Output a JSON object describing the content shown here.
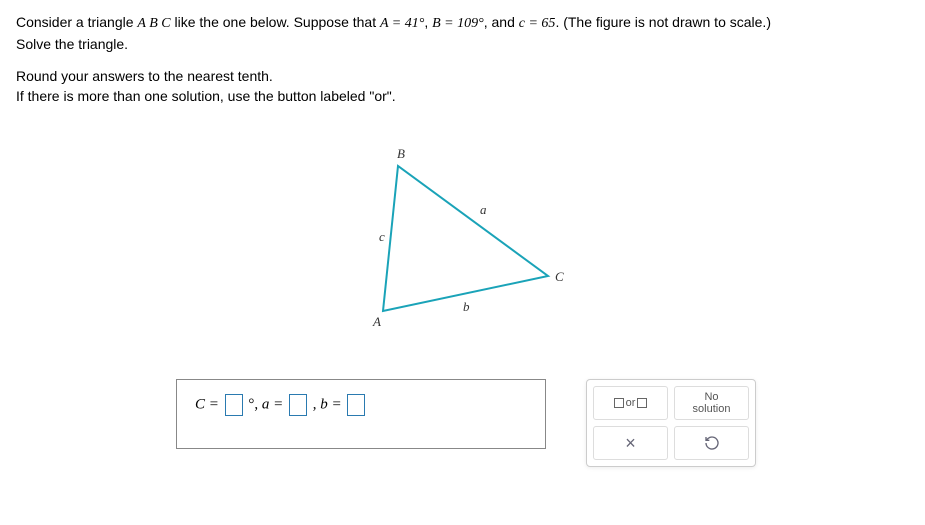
{
  "problem": {
    "line1_pre": "Consider a triangle ",
    "line1_abc": "A B C",
    "line1_mid": " like the one below. Suppose that ",
    "line1_A": "A = 41°",
    "line1_c1": ", ",
    "line1_B": "B = 109°",
    "line1_c2": ", and ",
    "line1_c": "c = 65",
    "line1_end": ". (The figure is not drawn to scale.)",
    "line2": "Solve the triangle."
  },
  "instructions": {
    "l1": "Round your answers to the nearest tenth.",
    "l2": "If there is more than one solution, use the button labeled \"or\"."
  },
  "figure": {
    "B": "B",
    "A": "A",
    "C": "C",
    "a": "a",
    "b": "b",
    "c": "c"
  },
  "answers": {
    "C_eq": "C = ",
    "deg_comma": "°, ",
    "a_eq": "a = ",
    "comma": ", ",
    "b_eq": "b = "
  },
  "toolbox": {
    "or_text": "or",
    "no_solution": "No\nsolution",
    "clear": "×",
    "reset": "↺"
  }
}
